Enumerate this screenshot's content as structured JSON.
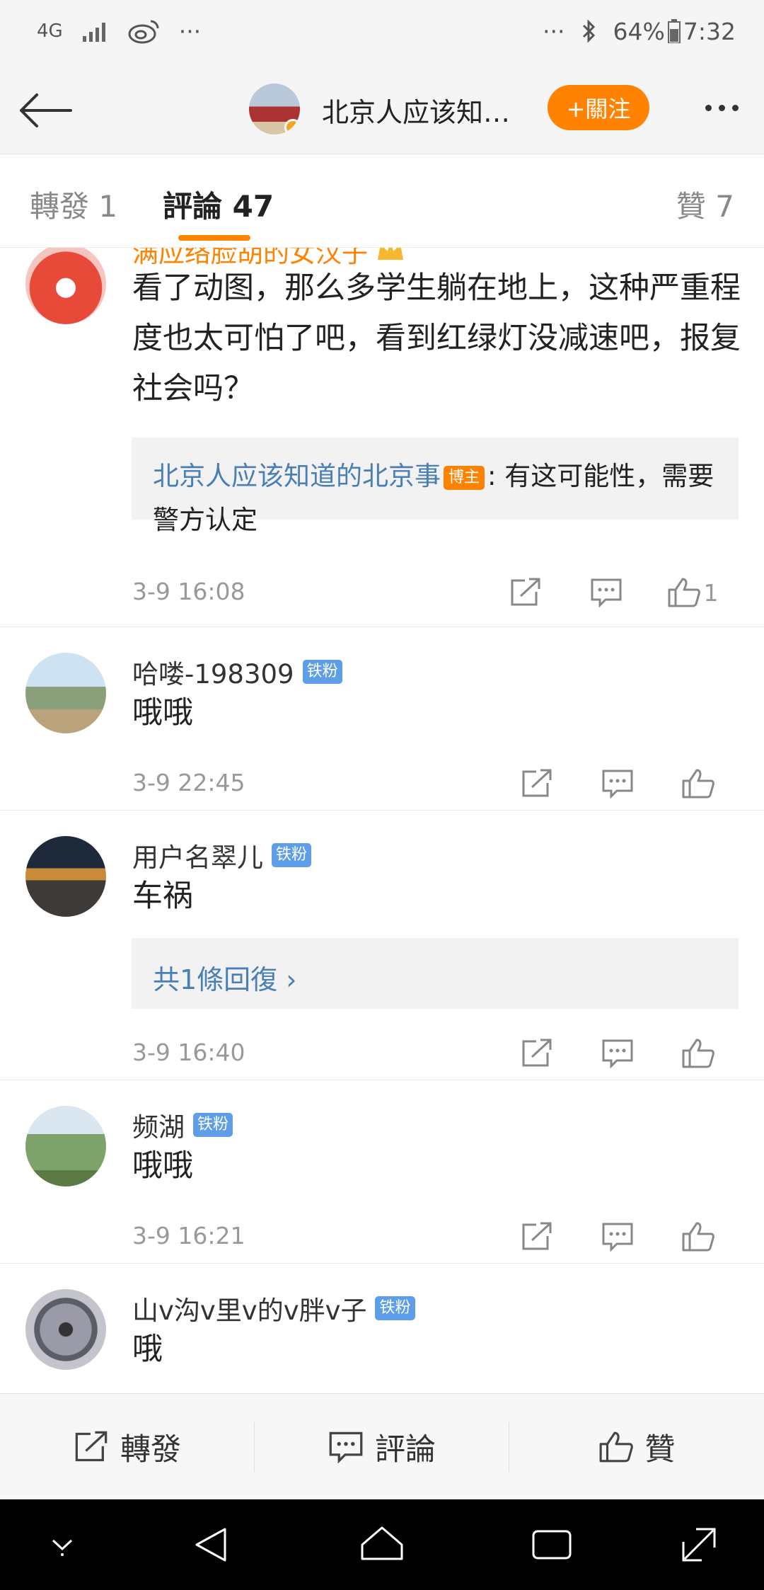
{
  "status_bar": {
    "network": "4G",
    "more": "···",
    "more_right": "···",
    "battery": "64%",
    "time": "7:32"
  },
  "header": {
    "title": "北京人应该知…",
    "follow_label": "+關注"
  },
  "tabs": [
    {
      "label": "轉發 1"
    },
    {
      "label": "評論 47"
    },
    {
      "label": "贊 7"
    }
  ],
  "comments": [
    {
      "username": "满应络脸胡的女汉子",
      "text": "看了动图，那么多学生躺在地上，这种严重程度也太可怕了吧，看到红绿灯没减速吧，报复社会吗？",
      "reply": {
        "author": "北京人应该知道的北京事",
        "badge": "博主",
        "text": ": 有这可能性，需要警方认定"
      },
      "time": "3-9 16:08",
      "likes": "1"
    },
    {
      "username": "哈喽-198309",
      "badge": "铁粉",
      "text": "哦哦",
      "time": "3-9 22:45"
    },
    {
      "username": "用户名翠儿",
      "badge": "铁粉",
      "text": "车祸",
      "more_replies": "共1條回復 ›",
      "time": "3-9 16:40"
    },
    {
      "username": "频湖",
      "badge": "铁粉",
      "text": "哦哦",
      "time": "3-9 16:21"
    },
    {
      "username": "山v沟v里v的v胖v子",
      "badge": "铁粉",
      "text": "哦"
    }
  ],
  "bottom_bar": {
    "repost": "轉發",
    "comment": "評論",
    "like": "贊"
  },
  "colors": {
    "accent": "#ff8200",
    "link": "#4a7fb5",
    "fan_badge": "#5e9ee8"
  }
}
